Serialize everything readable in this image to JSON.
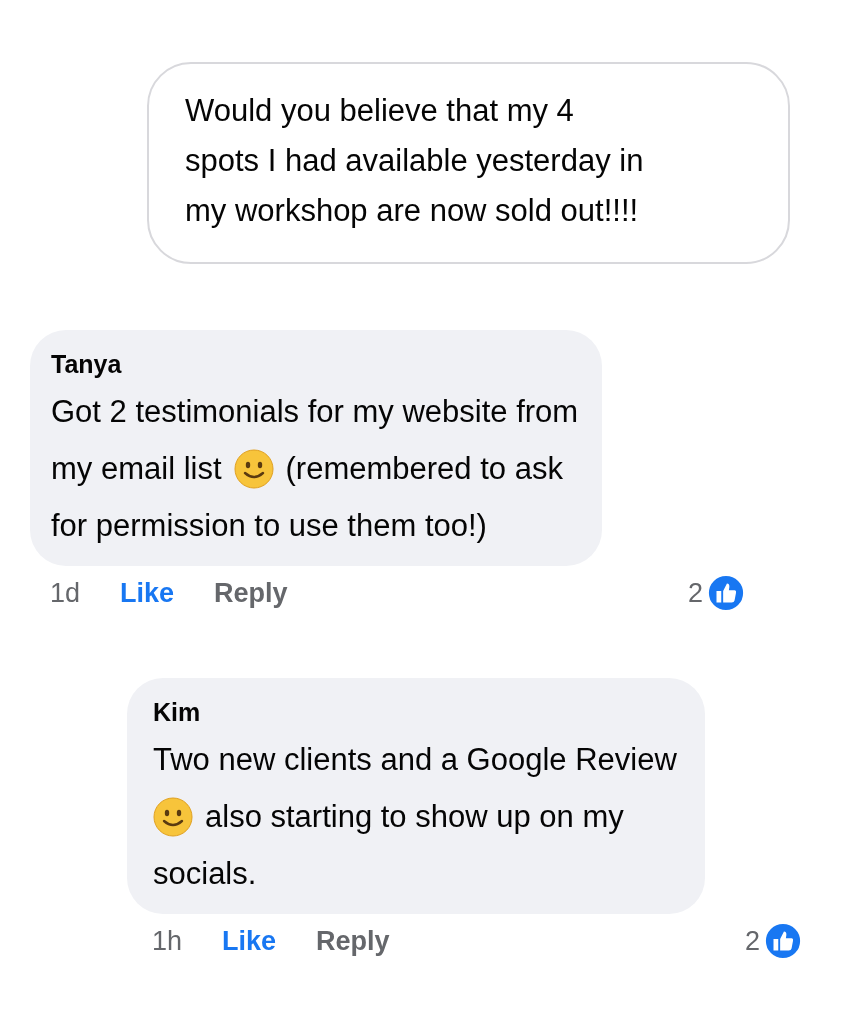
{
  "post": {
    "lines": [
      "Would you believe that my 4",
      "spots I had available yesterday in",
      "my workshop are now sold out!!!!"
    ]
  },
  "comments": [
    {
      "author": "Tanya",
      "indent": false,
      "lines": [
        [
          {
            "kind": "text",
            "text": "Got 2 testimonials for my website from"
          }
        ],
        [
          {
            "kind": "text",
            "text": "my email list"
          },
          {
            "kind": "emoji"
          },
          {
            "kind": "text",
            "text": "(remembered to ask"
          }
        ],
        [
          {
            "kind": "text",
            "text": "for permission to use them too!)"
          }
        ]
      ],
      "time": "1d",
      "like": "Like",
      "liked": true,
      "reply": "Reply",
      "reactions": "2"
    },
    {
      "author": "Kim",
      "indent": true,
      "lines": [
        [
          {
            "kind": "text",
            "text": "Two new clients and a Google Review"
          }
        ],
        [
          {
            "kind": "emoji"
          },
          {
            "kind": "text",
            "text": "also starting to show up on my"
          }
        ],
        [
          {
            "kind": "text",
            "text": "socials."
          }
        ]
      ],
      "time": "1h",
      "like": "Like",
      "liked": true,
      "reply": "Reply",
      "reactions": "2"
    }
  ]
}
